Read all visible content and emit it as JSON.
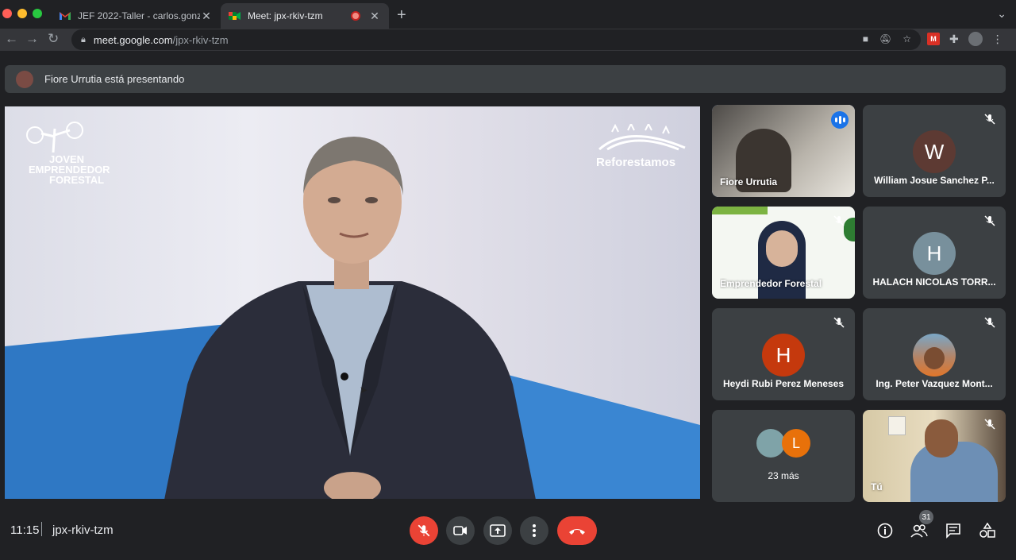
{
  "browser": {
    "tabs": [
      {
        "title": "JEF 2022-Taller - carlos.gonza",
        "favicon": "gmail-icon",
        "active": false
      },
      {
        "title": "Meet: jpx-rkiv-tzm",
        "favicon": "meet-icon",
        "active": true
      }
    ],
    "new_tab": "+",
    "url_host": "meet.google.com",
    "url_path": "/jpx-rkiv-tzm"
  },
  "banner": {
    "text": "Fiore Urrutia está presentando"
  },
  "stage": {
    "logo_left": [
      "JOVEN",
      "EMPRENDEDOR",
      "FORESTAL"
    ],
    "logo_right": "Reforestamos"
  },
  "tiles": [
    {
      "name": "Fiore Urrutia",
      "kind": "video",
      "speaking": true
    },
    {
      "name": "William Josue Sanchez P...",
      "kind": "avatar",
      "initial": "W",
      "color": "#5d3a33",
      "muted": true
    },
    {
      "name": "Emprendedor Forestal",
      "kind": "video",
      "muted": true
    },
    {
      "name": "HALACH NICOLAS TORR...",
      "kind": "avatar",
      "initial": "H",
      "color": "#78909c",
      "muted": true
    },
    {
      "name": "Heydi Rubi Perez Meneses",
      "kind": "avatar",
      "initial": "H",
      "color": "#c5390d",
      "muted": true
    },
    {
      "name": "Ing. Peter Vazquez Mont...",
      "kind": "photo",
      "muted": true
    },
    {
      "name": "23 más",
      "kind": "group",
      "initial": "L",
      "color": "#e8710a"
    },
    {
      "name": "Tú",
      "kind": "video",
      "muted": true
    }
  ],
  "bottom": {
    "time": "11:15",
    "meeting_code": "jpx-rkiv-tzm",
    "participants_count": "31"
  },
  "colors": {
    "accent": "#8ab4f8",
    "danger": "#ea4335",
    "surface": "#3c4043"
  }
}
